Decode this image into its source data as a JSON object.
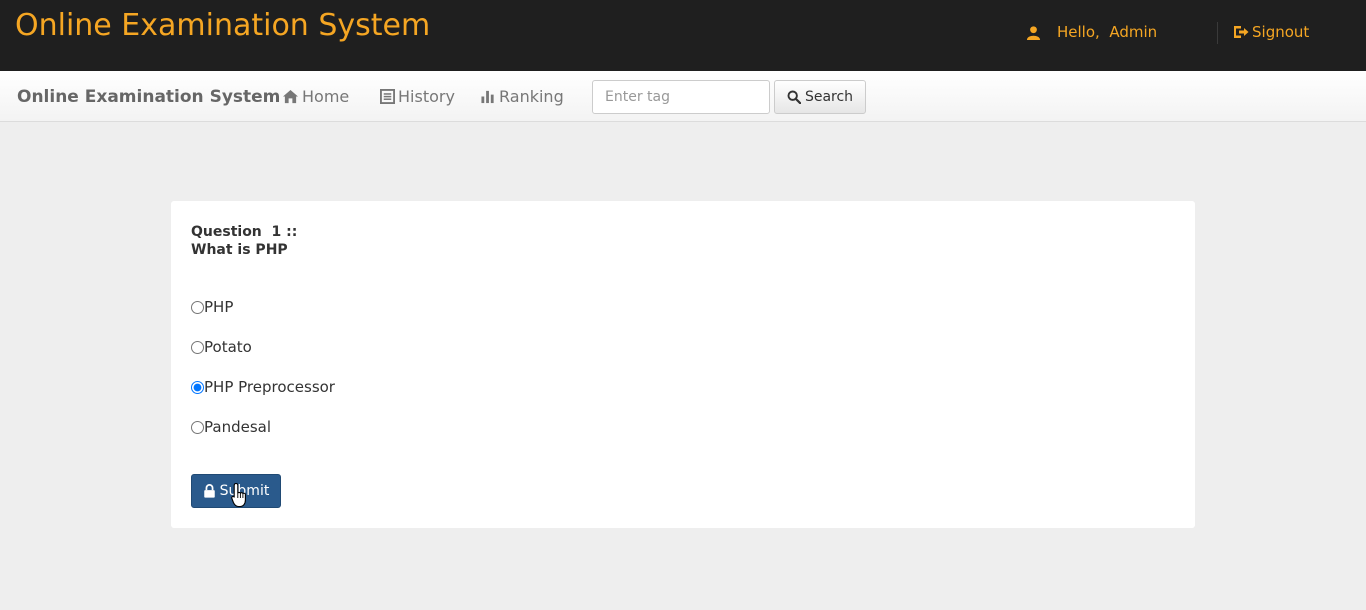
{
  "header": {
    "brand": "Online Examination System",
    "greeting": "Hello,  Admin",
    "signout": "Signout",
    "accent_color": "#f5a623"
  },
  "navbar": {
    "brand": "Online Examination System",
    "links": [
      {
        "label": "Home",
        "icon": "home-icon"
      },
      {
        "label": "History",
        "icon": "list-icon"
      },
      {
        "label": "Ranking",
        "icon": "bar-chart-icon"
      }
    ],
    "search": {
      "placeholder": "Enter tag",
      "value": "",
      "button_label": "Search"
    }
  },
  "question": {
    "title": "Question  1 ::",
    "text": "What is PHP",
    "options": [
      {
        "label": "PHP",
        "selected": false
      },
      {
        "label": "Potato",
        "selected": false
      },
      {
        "label": "PHP Preprocessor",
        "selected": true
      },
      {
        "label": "Pandesal",
        "selected": false
      }
    ],
    "submit_label": "Submit",
    "submit_color": "#2a5a8c"
  }
}
